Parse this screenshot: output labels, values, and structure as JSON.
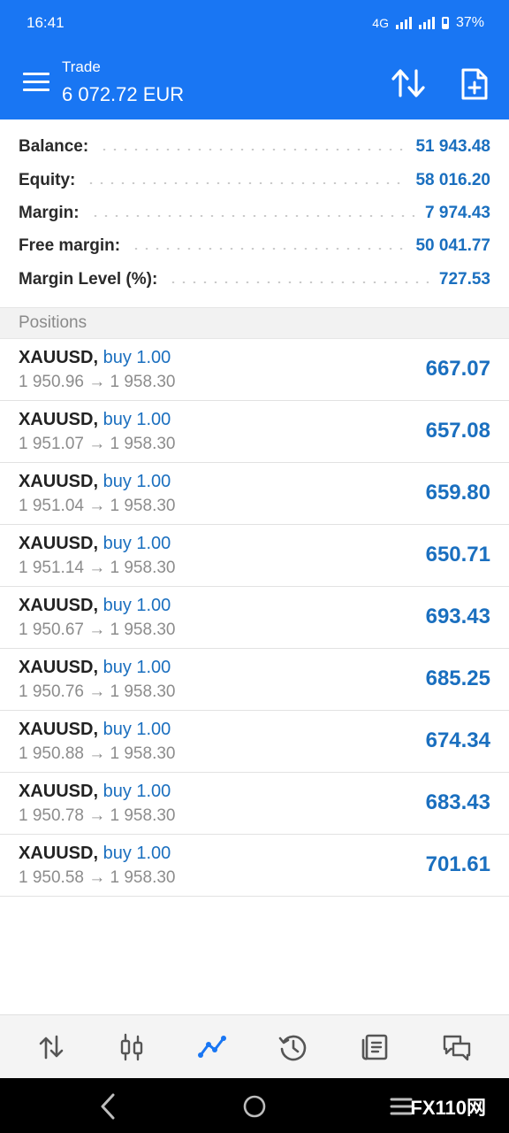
{
  "status_bar": {
    "time": "16:41",
    "network": "4G",
    "battery": "37%"
  },
  "header": {
    "title": "Trade",
    "balance": "6 072.72 EUR"
  },
  "summary": [
    {
      "label": "Balance:",
      "value": "51 943.48"
    },
    {
      "label": "Equity:",
      "value": "58 016.20"
    },
    {
      "label": "Margin:",
      "value": "7 974.43"
    },
    {
      "label": "Free margin:",
      "value": "50 041.77"
    },
    {
      "label": "Margin Level (%):",
      "value": "727.53"
    }
  ],
  "positions_header": "Positions",
  "positions": [
    {
      "symbol": "XAUUSD,",
      "side": "buy 1.00",
      "prices": "1 950.96 → 1 958.30",
      "profit": "667.07"
    },
    {
      "symbol": "XAUUSD,",
      "side": "buy 1.00",
      "prices": "1 951.07 → 1 958.30",
      "profit": "657.08"
    },
    {
      "symbol": "XAUUSD,",
      "side": "buy 1.00",
      "prices": "1 951.04 → 1 958.30",
      "profit": "659.80"
    },
    {
      "symbol": "XAUUSD,",
      "side": "buy 1.00",
      "prices": "1 951.14 → 1 958.30",
      "profit": "650.71"
    },
    {
      "symbol": "XAUUSD,",
      "side": "buy 1.00",
      "prices": "1 950.67 → 1 958.30",
      "profit": "693.43"
    },
    {
      "symbol": "XAUUSD,",
      "side": "buy 1.00",
      "prices": "1 950.76 → 1 958.30",
      "profit": "685.25"
    },
    {
      "symbol": "XAUUSD,",
      "side": "buy 1.00",
      "prices": "1 950.88 → 1 958.30",
      "profit": "674.34"
    },
    {
      "symbol": "XAUUSD,",
      "side": "buy 1.00",
      "prices": "1 950.78 → 1 958.30",
      "profit": "683.43"
    },
    {
      "symbol": "XAUUSD,",
      "side": "buy 1.00",
      "prices": "1 950.58 → 1 958.30",
      "profit": "701.61"
    }
  ],
  "bottom_nav": [
    {
      "icon": "quotes-icon",
      "active": false
    },
    {
      "icon": "chart-icon",
      "active": false
    },
    {
      "icon": "trade-icon",
      "active": true
    },
    {
      "icon": "history-icon",
      "active": false
    },
    {
      "icon": "news-icon",
      "active": false
    },
    {
      "icon": "messages-icon",
      "active": false
    }
  ],
  "watermark_brand": "FX110网",
  "colors": {
    "accent": "#1976f3",
    "value_blue": "#1a6fbf",
    "muted": "#8c8c8c"
  }
}
